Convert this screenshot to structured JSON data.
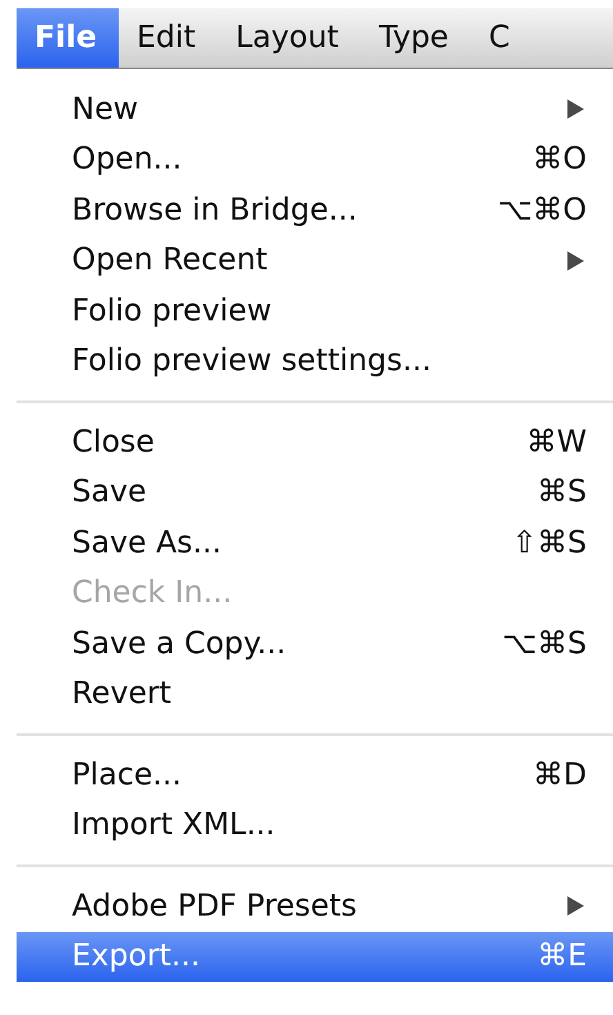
{
  "menubar": [
    {
      "label": "File",
      "selected": true
    },
    {
      "label": "Edit",
      "selected": false
    },
    {
      "label": "Layout",
      "selected": false
    },
    {
      "label": "Type",
      "selected": false
    },
    {
      "label": "C",
      "selected": false
    }
  ],
  "menu": {
    "groups": [
      {
        "items": [
          {
            "label": "New",
            "submenu": true,
            "disabled": false,
            "selected": false
          },
          {
            "label": "Open...",
            "shortcut": "⌘O",
            "disabled": false,
            "selected": false
          },
          {
            "label": "Browse in Bridge...",
            "shortcut": "⌥⌘O",
            "disabled": false,
            "selected": false
          },
          {
            "label": "Open Recent",
            "submenu": true,
            "disabled": false,
            "selected": false
          },
          {
            "label": "Folio preview",
            "disabled": false,
            "selected": false
          },
          {
            "label": "Folio preview settings...",
            "disabled": false,
            "selected": false
          }
        ]
      },
      {
        "items": [
          {
            "label": "Close",
            "shortcut": "⌘W",
            "disabled": false,
            "selected": false
          },
          {
            "label": "Save",
            "shortcut": "⌘S",
            "disabled": false,
            "selected": false
          },
          {
            "label": "Save As...",
            "shortcut": "⇧⌘S",
            "disabled": false,
            "selected": false
          },
          {
            "label": "Check In...",
            "disabled": true,
            "selected": false
          },
          {
            "label": "Save a Copy...",
            "shortcut": "⌥⌘S",
            "disabled": false,
            "selected": false
          },
          {
            "label": "Revert",
            "disabled": false,
            "selected": false
          }
        ]
      },
      {
        "items": [
          {
            "label": "Place...",
            "shortcut": "⌘D",
            "disabled": false,
            "selected": false
          },
          {
            "label": "Import XML...",
            "disabled": false,
            "selected": false
          }
        ]
      },
      {
        "items": [
          {
            "label": "Adobe PDF Presets",
            "submenu": true,
            "disabled": false,
            "selected": false
          },
          {
            "label": "Export...",
            "shortcut": "⌘E",
            "disabled": false,
            "selected": true
          }
        ]
      }
    ]
  }
}
